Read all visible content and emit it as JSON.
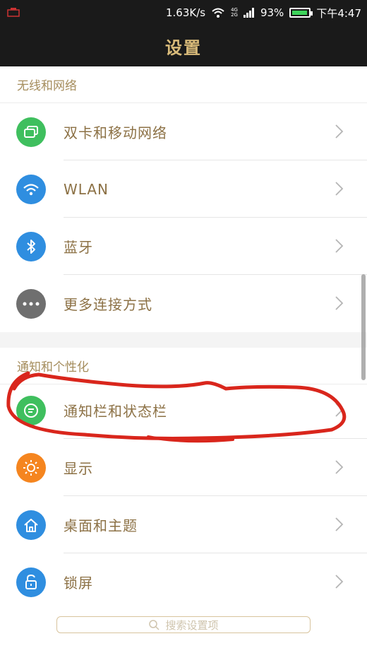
{
  "status_bar": {
    "speed": "1.63K/s",
    "network_top": "4G",
    "network_bottom": "2G",
    "battery_percent": "93%",
    "battery_level": 0.93,
    "time": "下午4:47"
  },
  "header": {
    "title": "设置"
  },
  "sections": [
    {
      "title": "无线和网络",
      "items": [
        {
          "label": "双卡和移动网络",
          "icon": "sim-cards-icon",
          "color": "#3fbf5e"
        },
        {
          "label": "WLAN",
          "icon": "wifi-icon",
          "color": "#2f8ee0"
        },
        {
          "label": "蓝牙",
          "icon": "bluetooth-icon",
          "color": "#2f8ee0"
        },
        {
          "label": "更多连接方式",
          "icon": "more-dots-icon",
          "color": "#6f6f6f"
        }
      ]
    },
    {
      "title": "通知和个性化",
      "items": [
        {
          "label": "通知栏和状态栏",
          "icon": "notification-icon",
          "color": "#3fbf5e"
        },
        {
          "label": "显示",
          "icon": "brightness-icon",
          "color": "#f5851f"
        },
        {
          "label": "桌面和主题",
          "icon": "home-icon",
          "color": "#2f8ee0"
        },
        {
          "label": "锁屏",
          "icon": "lock-icon",
          "color": "#2f8ee0"
        }
      ]
    }
  ],
  "search": {
    "placeholder": "搜索设置项"
  },
  "colors": {
    "accent_text": "#8c7145",
    "section_text": "#a58d5d",
    "title_gold": "#d9bb7a",
    "annotation_red": "#d9261c"
  }
}
